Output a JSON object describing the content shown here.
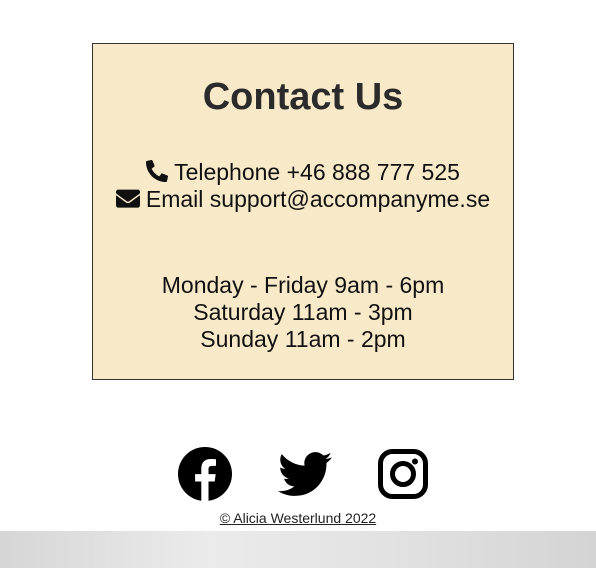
{
  "contact": {
    "title": "Contact Us",
    "phone_text": "Telephone +46 888 777 525",
    "email_text": "Email support@accompanyme.se",
    "hours": [
      "Monday - Friday 9am - 6pm",
      "Saturday 11am - 3pm",
      "Sunday 11am - 2pm"
    ],
    "phone_icon": "phone-icon",
    "email_icon": "envelope-icon"
  },
  "social": {
    "icons": [
      "facebook-icon",
      "twitter-icon",
      "instagram-icon"
    ]
  },
  "footer": {
    "copyright": "© Alicia Westerlund 2022"
  },
  "colors": {
    "box_background": "#f8e9c9",
    "box_border": "#333333"
  }
}
